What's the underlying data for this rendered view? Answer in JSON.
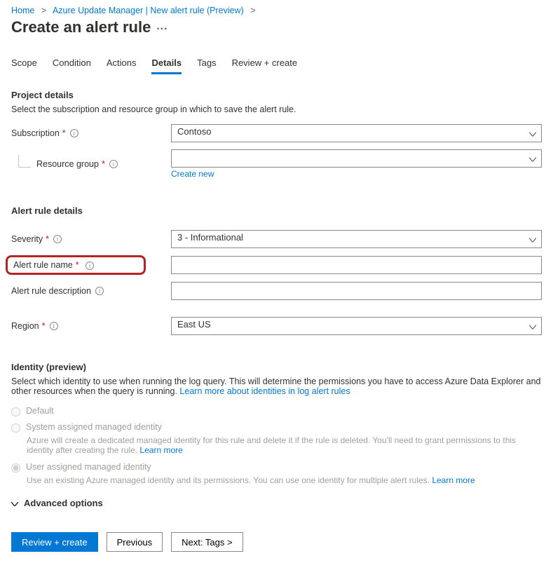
{
  "breadcrumb": {
    "home": "Home",
    "page": "Azure Update Manager | New alert rule (Preview)"
  },
  "page_title": "Create an alert rule",
  "tabs": [
    {
      "label": "Scope",
      "active": false
    },
    {
      "label": "Condition",
      "active": false
    },
    {
      "label": "Actions",
      "active": false
    },
    {
      "label": "Details",
      "active": true
    },
    {
      "label": "Tags",
      "active": false
    },
    {
      "label": "Review + create",
      "active": false
    }
  ],
  "project_details": {
    "heading": "Project details",
    "desc": "Select the subscription and resource group in which to save the alert rule.",
    "subscription_label": "Subscription",
    "subscription_value": "Contoso",
    "resource_group_label": "Resource group",
    "resource_group_value": "",
    "create_new": "Create new"
  },
  "alert_rule_details": {
    "heading": "Alert rule details",
    "severity_label": "Severity",
    "severity_value": "3 - Informational",
    "name_label": "Alert rule name",
    "name_value": "",
    "description_label": "Alert rule description",
    "description_value": "",
    "region_label": "Region",
    "region_value": "East US"
  },
  "identity": {
    "heading": "Identity (preview)",
    "desc_pre": "Select which identity to use when running the log query. This will determine the permissions you have to access Azure Data Explorer and other resources when the query is running. ",
    "desc_link": "Learn more about identities in log alert rules",
    "options": {
      "default_label": "Default",
      "system_label": "System assigned managed identity",
      "system_sub_pre": "Azure will create a dedicated managed identity for this rule and delete it if the rule is deleted. You'll need to grant permissions to this identity after creating the rule. ",
      "system_sub_link": "Learn more",
      "user_label": "User assigned managed identity",
      "user_sub_pre": "Use an existing Azure managed identity and its permissions. You can use one identity for multiple alert rules. ",
      "user_sub_link": "Learn more"
    }
  },
  "advanced_options": "Advanced options",
  "footer": {
    "review": "Review + create",
    "previous": "Previous",
    "next": "Next: Tags >"
  }
}
